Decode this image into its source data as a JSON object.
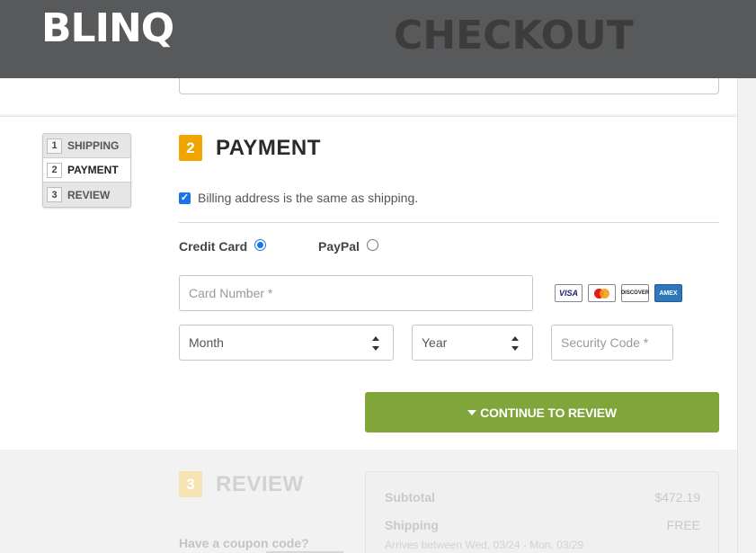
{
  "header": {
    "logo": "BLINQ",
    "title": "CHECKOUT"
  },
  "steps": [
    {
      "num": "1",
      "label": "SHIPPING"
    },
    {
      "num": "2",
      "label": "PAYMENT"
    },
    {
      "num": "3",
      "label": "REVIEW"
    }
  ],
  "payment": {
    "num": "2",
    "title": "PAYMENT",
    "billing_same": "Billing address is the same as shipping.",
    "method_credit": "Credit Card",
    "method_paypal": "PayPal",
    "card_number_placeholder": "Card Number *",
    "month_value": "Month",
    "year_value": "Year",
    "security_placeholder": "Security Code *",
    "cards": [
      "VISA",
      "MasterCard",
      "DISCOVER",
      "AMEX"
    ],
    "continue_label": "CONTINUE TO REVIEW",
    "colors": {
      "accent": "#f0a500",
      "button": "#80a53a",
      "radio": "#1a73e8"
    }
  },
  "review": {
    "num": "3",
    "title": "REVIEW",
    "coupon_label": "Have a coupon code?",
    "subtotal_label": "Subtotal",
    "subtotal_value": "$472.19",
    "shipping_label": "Shipping",
    "shipping_value": "FREE",
    "arrives": "Arrives between Wed, 03/24 - Mon, 03/29"
  }
}
